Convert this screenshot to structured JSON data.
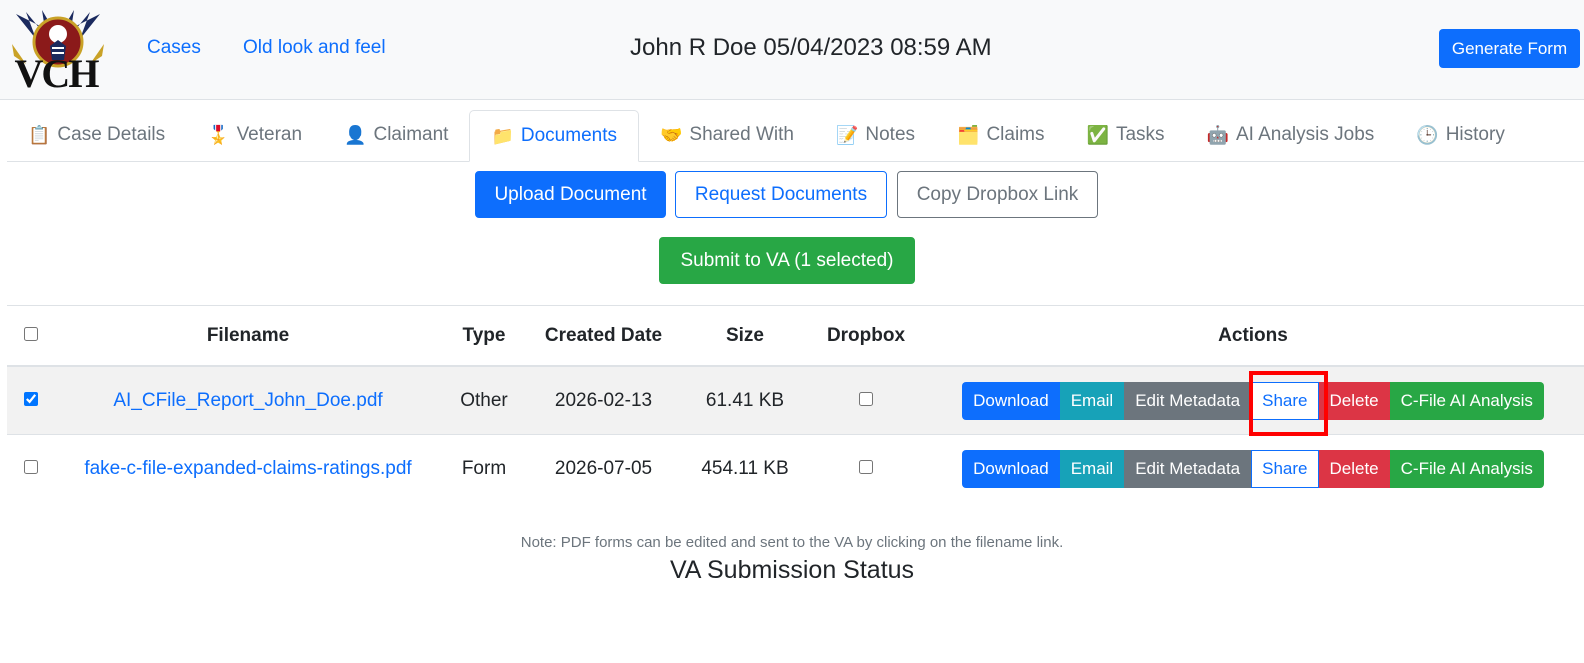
{
  "header": {
    "logo_text": "VCH",
    "nav": [
      {
        "label": "Cases"
      },
      {
        "label": "Old look and feel"
      }
    ],
    "title": "John R Doe 05/04/2023 08:59 AM",
    "generate_button": "Generate Form"
  },
  "tabs": [
    {
      "icon": "📋",
      "label": "Case Details",
      "active": false
    },
    {
      "icon": "🎖️",
      "label": "Veteran",
      "active": false
    },
    {
      "icon": "👤",
      "label": "Claimant",
      "active": false
    },
    {
      "icon": "📁",
      "label": "Documents",
      "active": true
    },
    {
      "icon": "🤝",
      "label": "Shared With",
      "active": false
    },
    {
      "icon": "📝",
      "label": "Notes",
      "active": false
    },
    {
      "icon": "🗂️",
      "label": "Claims",
      "active": false
    },
    {
      "icon": "✅",
      "label": "Tasks",
      "active": false
    },
    {
      "icon": "🤖",
      "label": "AI Analysis Jobs",
      "active": false
    },
    {
      "icon": "🕒",
      "label": "History",
      "active": false
    }
  ],
  "actions": {
    "upload": "Upload Document",
    "request": "Request Documents",
    "copy_link": "Copy Dropbox Link",
    "submit": "Submit to VA (1 selected)"
  },
  "table": {
    "headers": {
      "filename": "Filename",
      "type": "Type",
      "created": "Created Date",
      "size": "Size",
      "dropbox": "Dropbox",
      "actions": "Actions"
    },
    "rows": [
      {
        "selected": true,
        "filename": "AI_CFile_Report_John_Doe.pdf",
        "type": "Other",
        "created": "2026-02-13",
        "size": "61.41 KB",
        "dropbox": false
      },
      {
        "selected": false,
        "filename": "fake-c-file-expanded-claims-ratings.pdf",
        "type": "Form",
        "created": "2026-07-05",
        "size": "454.11 KB",
        "dropbox": false
      }
    ],
    "row_actions": {
      "download": "Download",
      "email": "Email",
      "edit": "Edit Metadata",
      "share": "Share",
      "delete": "Delete",
      "cfile": "C-File AI Analysis"
    }
  },
  "note": "Note: PDF forms can be edited and sent to the VA by clicking on the filename link.",
  "status_title": "VA Submission Status",
  "colors": {
    "primary": "#0d6efd",
    "success": "#28a745",
    "info": "#17a2b8",
    "secondary": "#6c757d",
    "danger": "#dc3545",
    "highlight": "#ff0000"
  }
}
